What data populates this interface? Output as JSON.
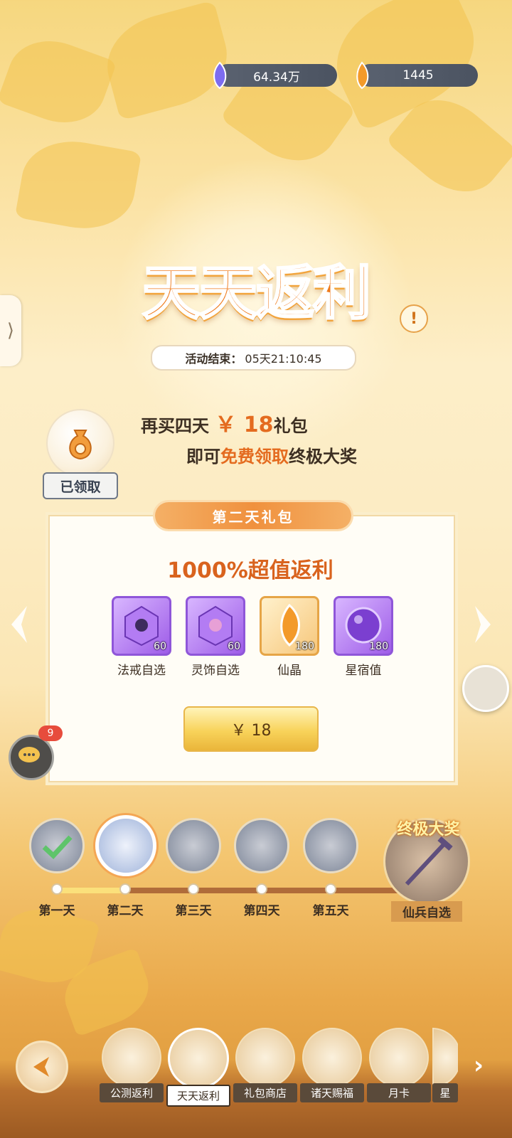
{
  "currencies": [
    {
      "name": "spirit-jade",
      "value": "64.34万"
    },
    {
      "name": "immortal-crystal",
      "value": "1445"
    }
  ],
  "event": {
    "title": "天天返利",
    "timer_label": "活动结束：",
    "timer_value": "05天21:10:45"
  },
  "promo": {
    "line1_pre": "再买四天",
    "line1_price": "￥ 18",
    "line1_post": "礼包",
    "line2_pre": "即可",
    "line2_hl": "免费领取",
    "line2_post": "终极大奖",
    "claimed_label": "已领取"
  },
  "pack": {
    "ribbon": "第二天礼包",
    "rebate": "1000%超值返利",
    "items": [
      {
        "label": "法戒自选",
        "count": "60",
        "icon": "ring-chest-icon",
        "frame": "purple"
      },
      {
        "label": "灵饰自选",
        "count": "60",
        "icon": "ornament-chest-icon",
        "frame": "purple"
      },
      {
        "label": "仙晶",
        "count": "180",
        "icon": "crystal-icon",
        "frame": "gold"
      },
      {
        "label": "星宿值",
        "count": "180",
        "icon": "star-orb-icon",
        "frame": "purple"
      }
    ],
    "buy_label": "￥ 18"
  },
  "chat": {
    "badge": "9"
  },
  "days": [
    {
      "label": "第一天"
    },
    {
      "label": "第二天"
    },
    {
      "label": "第三天"
    },
    {
      "label": "第四天"
    },
    {
      "label": "第五天"
    }
  ],
  "grand_prize": {
    "tag": "终极大奖",
    "label": "仙兵自选"
  },
  "nav": [
    {
      "label": "公测返利"
    },
    {
      "label": "天天返利"
    },
    {
      "label": "礼包商店"
    },
    {
      "label": "诸天赐福"
    },
    {
      "label": "月卡"
    },
    {
      "label": "星"
    }
  ],
  "colors": {
    "accent": "#e46b1f",
    "title": "#ef7a1b",
    "purple_frame": "#8f56d9",
    "gold_frame": "#e6a547"
  }
}
